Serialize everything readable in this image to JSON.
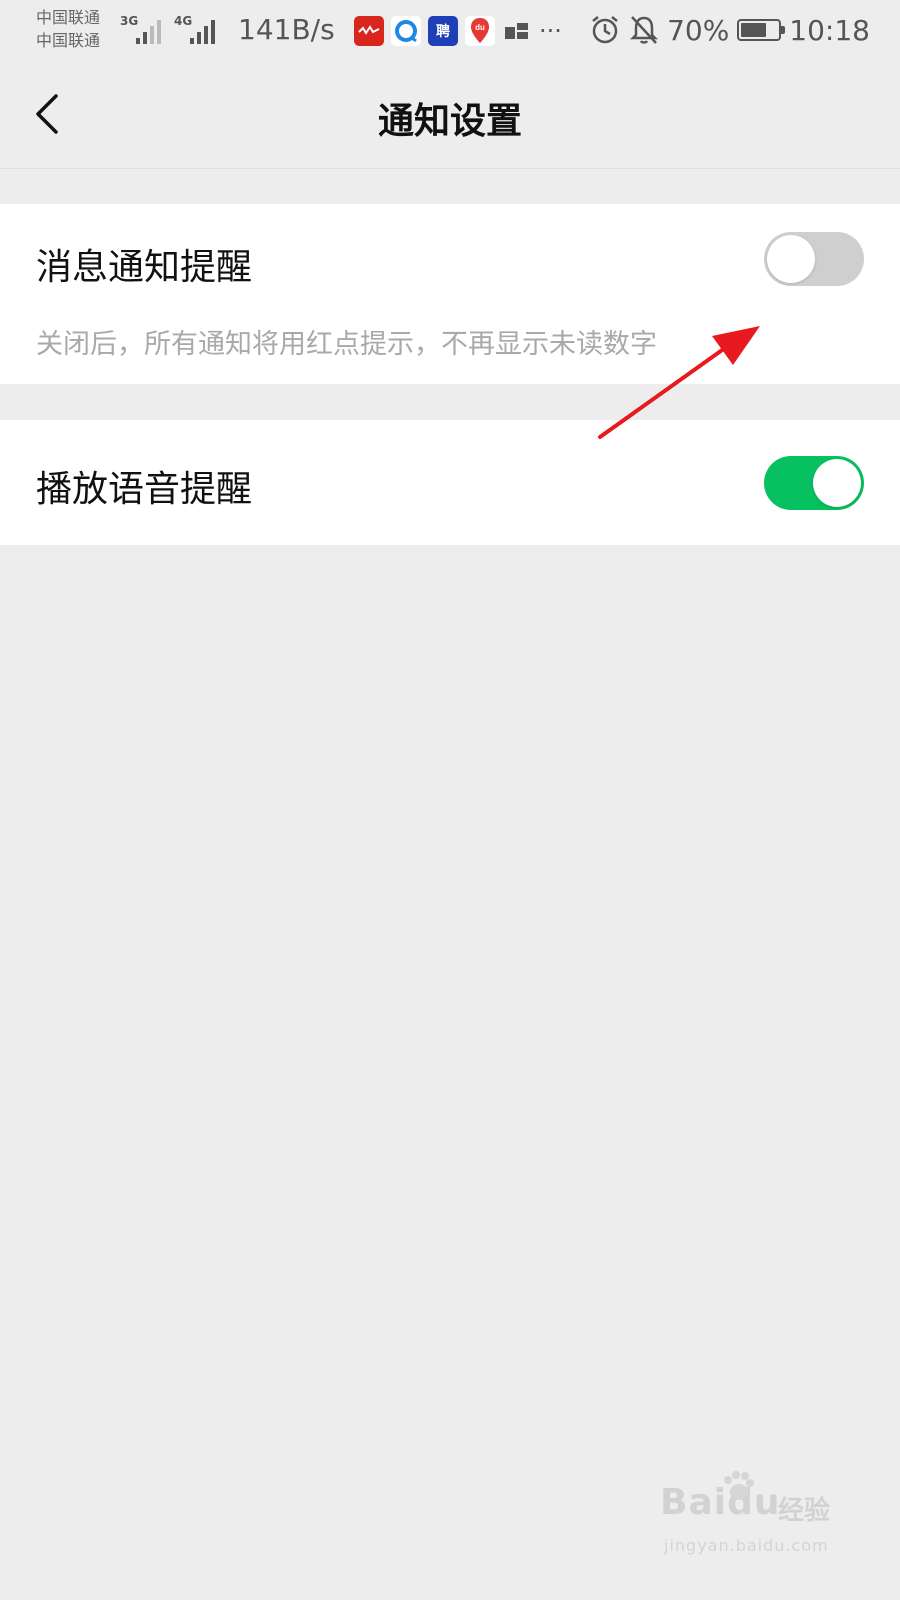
{
  "status_bar": {
    "carrier_1": "中国联通",
    "carrier_2": "中国联通",
    "sig1_type": "3G",
    "sig2_type": "4G",
    "net_speed": "141B/s",
    "more": "···",
    "battery_percent": "70%",
    "battery_level": 0.7,
    "time": "10:18",
    "app_icons": [
      "news-app-icon",
      "browser-app-icon",
      "job-app-icon",
      "maps-app-icon",
      "grid-app-icon"
    ],
    "app_icon_texts": [
      "",
      "",
      "聘",
      "du",
      ""
    ]
  },
  "header": {
    "title": "通知设置"
  },
  "settings": {
    "message_notification": {
      "label": "消息通知提醒",
      "description": "关闭后，所有通知将用红点提示，不再显示未读数字",
      "enabled": false
    },
    "voice_reminder": {
      "label": "播放语音提醒",
      "enabled": true
    }
  },
  "colors": {
    "page_background": "#ededed",
    "toggle_on": "#07c160",
    "toggle_off": "#cfcfcf",
    "annotation_arrow": "#e8191f"
  },
  "watermark": {
    "brand": "Baidu",
    "sub": "经验",
    "url": "jingyan.baidu.com"
  }
}
